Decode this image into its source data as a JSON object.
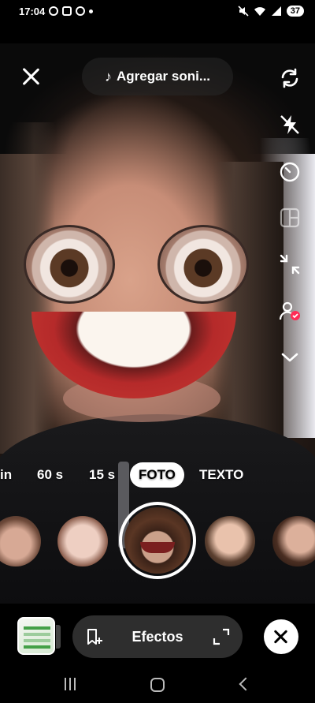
{
  "status_bar": {
    "time": "17:04",
    "notification_icons": [
      "facebook-icon",
      "screenshot-icon",
      "pinterest-icon",
      "dot-icon"
    ],
    "system_icons": [
      "mute-icon",
      "wifi-icon",
      "signal-icon"
    ],
    "battery": "37"
  },
  "top": {
    "add_sound_label": "Agregar soni...",
    "close_icon": "close-icon"
  },
  "right_rail": [
    "flip-camera-icon",
    "flash-off-icon",
    "timer-icon",
    "layout-icon",
    "retouch-icon",
    "effects-people-icon",
    "chevron-down-icon"
  ],
  "modes": [
    {
      "label": "in",
      "active": false
    },
    {
      "label": "60 s",
      "active": false
    },
    {
      "label": "15 s",
      "active": false
    },
    {
      "label": "FOTO",
      "active": true
    },
    {
      "label": "TEXTO",
      "active": false
    }
  ],
  "effects_carousel": {
    "items": [
      "effect-1",
      "effect-2",
      "effect-selected",
      "effect-4",
      "effect-5"
    ]
  },
  "bottom_bar": {
    "effects_label": "Efectos"
  },
  "colors": {
    "accent_red": "#fe2c55",
    "pill_bg": "#2e2e2e"
  }
}
